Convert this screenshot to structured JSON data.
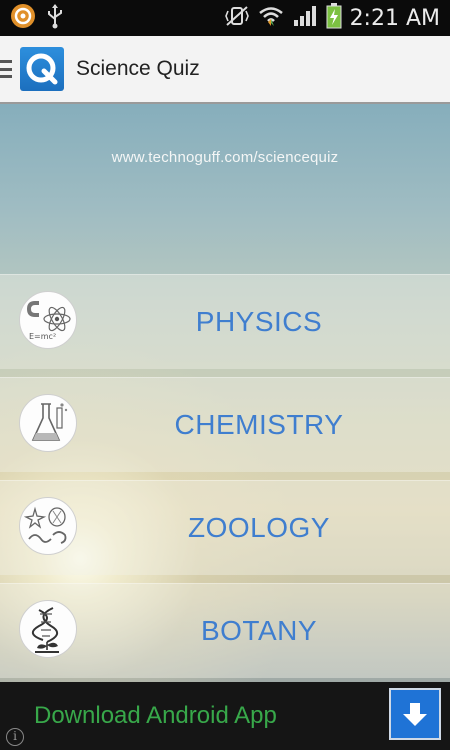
{
  "status_bar": {
    "time": "2:21 AM",
    "icons": [
      "app-notification-icon",
      "usb-icon",
      "vibrate-mute-icon",
      "wifi-icon",
      "signal-icon",
      "battery-charging-icon"
    ]
  },
  "action_bar": {
    "title": "Science Quiz",
    "logo_letter": "Q",
    "icons": [
      "menu-icon",
      "app-logo-icon"
    ]
  },
  "main": {
    "site_url": "www.technoguff.com/sciencequiz",
    "categories": [
      {
        "label": "PHYSICS",
        "icon": "physics-icon",
        "icon_caption": "E=mc²"
      },
      {
        "label": "CHEMISTRY",
        "icon": "flask-icon"
      },
      {
        "label": "ZOOLOGY",
        "icon": "animals-icon"
      },
      {
        "label": "BOTANY",
        "icon": "dna-plant-icon"
      }
    ]
  },
  "ad_bar": {
    "text": "Download Android App",
    "info_glyph": "i",
    "icons": [
      "download-arrow-icon",
      "info-icon"
    ],
    "colors": {
      "text": "#38a84a",
      "button": "#1f73d6"
    }
  },
  "colors": {
    "category_label": "#3f7ecf",
    "action_bar": "#f3f3f3",
    "status_bar": "#0b0b0b"
  }
}
